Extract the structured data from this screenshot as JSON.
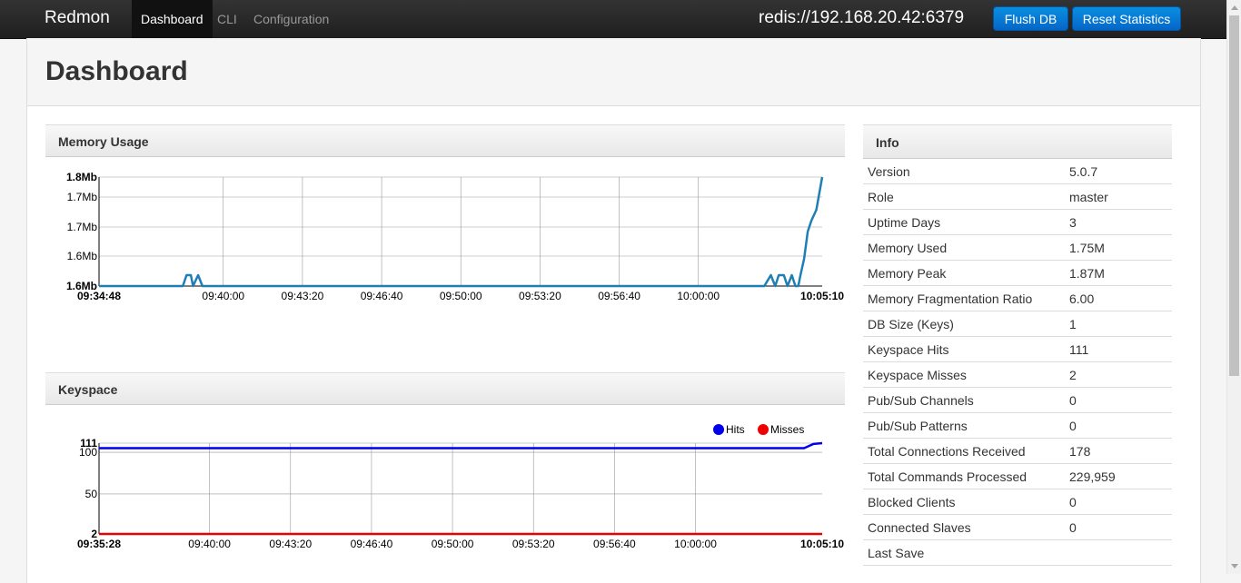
{
  "nav": {
    "brand": "Redmon",
    "items": [
      {
        "label": "Dashboard",
        "active": true
      },
      {
        "label": "CLI",
        "active": false
      },
      {
        "label": "Configuration",
        "active": false
      }
    ],
    "redis_url": "redis://192.168.20.42:6379",
    "flush_label": "Flush DB",
    "reset_label": "Reset Statistics",
    "button_color": "#0a8fe0"
  },
  "page_title": "Dashboard",
  "memory_panel": {
    "title": "Memory Usage"
  },
  "keyspace_panel": {
    "title": "Keyspace"
  },
  "info_panel": {
    "title": "Info",
    "rows": [
      {
        "label": "Version",
        "value": "5.0.7"
      },
      {
        "label": "Role",
        "value": "master"
      },
      {
        "label": "Uptime Days",
        "value": "3"
      },
      {
        "label": "Memory Used",
        "value": "1.75M"
      },
      {
        "label": "Memory Peak",
        "value": "1.87M"
      },
      {
        "label": "Memory Fragmentation Ratio",
        "value": "6.00"
      },
      {
        "label": "DB Size (Keys)",
        "value": "1"
      },
      {
        "label": "Keyspace Hits",
        "value": "111"
      },
      {
        "label": "Keyspace Misses",
        "value": "2"
      },
      {
        "label": "Pub/Sub Channels",
        "value": "0"
      },
      {
        "label": "Pub/Sub Patterns",
        "value": "0"
      },
      {
        "label": "Total Connections Received",
        "value": "178"
      },
      {
        "label": "Total Commands Processed",
        "value": "229,959"
      },
      {
        "label": "Blocked Clients",
        "value": "0"
      },
      {
        "label": "Connected Slaves",
        "value": "0"
      },
      {
        "label": "Last Save",
        "value": ""
      }
    ]
  },
  "chart_data": [
    {
      "type": "line",
      "title": "Memory Usage",
      "x_tick_labels": [
        "09:34:48",
        "09:40:00",
        "09:43:20",
        "09:46:40",
        "09:50:00",
        "09:53:20",
        "09:56:40",
        "10:00:00",
        "10:05:10"
      ],
      "x_tick_positions": [
        0,
        0.1718,
        0.2813,
        0.3908,
        0.5003,
        0.6098,
        0.7193,
        0.8288,
        1.0
      ],
      "y_tick_labels": [
        "1.8Mb",
        "1.7Mb",
        "1.7Mb",
        "1.6Mb",
        "1.6Mb"
      ],
      "ylim": [
        1.6,
        1.8
      ],
      "grid": true,
      "series": [
        {
          "color": "#1f7fb4",
          "x": [
            0,
            0.116,
            0.121,
            0.127,
            0.13,
            0.137,
            0.143,
            0.92,
            0.929,
            0.935,
            0.94,
            0.947,
            0.952,
            0.958,
            0.963,
            0.967,
            0.97,
            0.975,
            0.98,
            0.985,
            0.992,
            1.0
          ],
          "y": [
            1.6,
            1.6,
            1.62,
            1.62,
            1.6,
            1.62,
            1.6,
            1.6,
            1.62,
            1.6,
            1.62,
            1.62,
            1.6,
            1.62,
            1.6,
            1.6,
            1.62,
            1.65,
            1.7,
            1.72,
            1.74,
            1.8
          ]
        }
      ]
    },
    {
      "type": "line",
      "title": "Keyspace",
      "x_tick_labels": [
        "09:35:28",
        "09:40:00",
        "09:43:20",
        "09:46:40",
        "09:50:00",
        "09:53:20",
        "09:56:40",
        "10:00:00",
        "10:05:10"
      ],
      "x_tick_positions": [
        0,
        0.1528,
        0.2648,
        0.3768,
        0.4888,
        0.6008,
        0.7128,
        0.8248,
        1.0
      ],
      "y_tick_labels": [
        "111",
        "100",
        "50",
        "2"
      ],
      "y_tick_values": [
        111,
        100,
        50,
        2
      ],
      "ylim": [
        2,
        111
      ],
      "grid": true,
      "legend": "top-right",
      "series": [
        {
          "name": "Hits",
          "color": "#0000ee",
          "x": [
            0,
            0.975,
            0.988,
            1.0
          ],
          "y": [
            105,
            105,
            110,
            111
          ]
        },
        {
          "name": "Misses",
          "color": "#ee0000",
          "x": [
            0,
            1.0
          ],
          "y": [
            2,
            2
          ]
        }
      ]
    }
  ]
}
